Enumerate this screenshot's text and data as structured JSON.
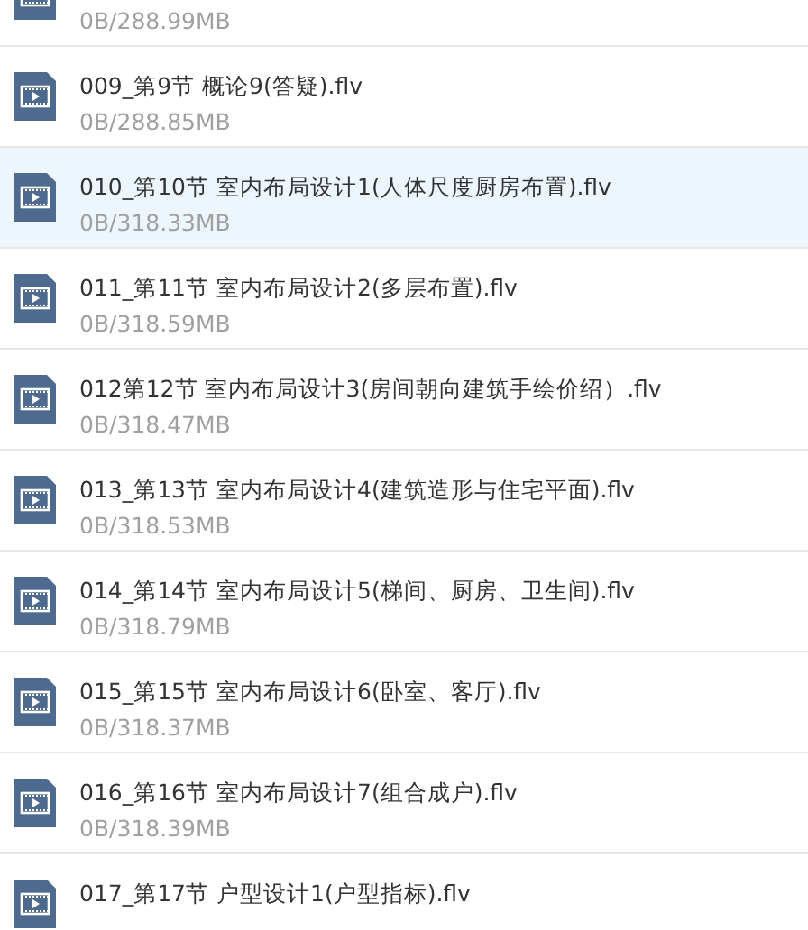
{
  "files": [
    {
      "size": "0B/288.99MB",
      "selected": false
    },
    {
      "name": "009_第9节  概论9(答疑).flv",
      "size": "0B/288.85MB",
      "selected": false
    },
    {
      "name": "010_第10节  室内布局设计1(人体尺度厨房布置).flv",
      "size": "0B/318.33MB",
      "selected": true
    },
    {
      "name": "011_第11节  室内布局设计2(多层布置).flv",
      "size": "0B/318.59MB",
      "selected": false
    },
    {
      "name": "012第12节 室内布局设计3(房间朝向建筑手绘价绍）.flv",
      "size": "0B/318.47MB",
      "selected": false
    },
    {
      "name": "013_第13节  室内布局设计4(建筑造形与住宅平面).flv",
      "size": "0B/318.53MB",
      "selected": false
    },
    {
      "name": "014_第14节  室内布局设计5(梯间、厨房、卫生间).flv",
      "size": "0B/318.79MB",
      "selected": false
    },
    {
      "name": "015_第15节  室内布局设计6(卧室、客厅).flv",
      "size": "0B/318.37MB",
      "selected": false
    },
    {
      "name": "016_第16节  室内布局设计7(组合成户).flv",
      "size": "0B/318.39MB",
      "selected": false
    },
    {
      "name": "017_第17节  户型设计1(户型指标).flv",
      "selected": false
    }
  ]
}
